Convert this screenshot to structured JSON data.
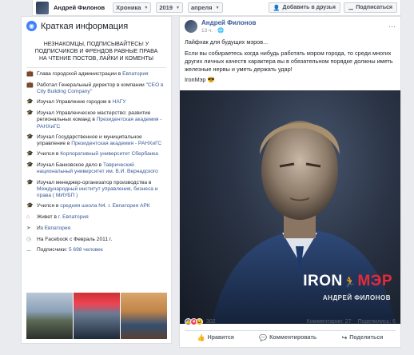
{
  "topbar": {
    "profile_name": "Андрей Филонов",
    "timeline_label": "Хроника",
    "year": "2019",
    "month": "апреля",
    "add_friend": "Добавить в друзья",
    "subscribe": "Подписаться"
  },
  "intro": {
    "title": "Краткая информация",
    "bio": "НЕЗНАКОМЦЫ, ПОДПИСЫВАЙТЕСЬ! У ПОДПИСЧИКОВ И ФРЕНДОВ РАВНЫЕ ПРАВА НА ЧТЕНИЕ ПОСТОВ, ЛАЙКИ И КОМЕНТЫ",
    "items": [
      {
        "icon": "briefcase-icon",
        "text": "Глава городской администрации в ",
        "link": "Евпатория"
      },
      {
        "icon": "briefcase-icon",
        "text": "Работал Генеральный директор в компании ",
        "link": "\"CEO в City Building Company\""
      },
      {
        "icon": "graduation-icon",
        "text": "Изучал Управление городом в ",
        "link": "НАГУ"
      },
      {
        "icon": "graduation-icon",
        "text": "Изучал Управленческое мастерство: развитие региональных команд в ",
        "link": "Президентская академия - РАНХиГС"
      },
      {
        "icon": "graduation-icon",
        "text": "Изучал Государственное и муниципальное управление в ",
        "link": "Президентская академия - РАНХиГС"
      },
      {
        "icon": "graduation-icon",
        "text": "Учился в ",
        "link": "Корпоративный университет Сбербанка"
      },
      {
        "icon": "graduation-icon",
        "text": "Изучал Банковское дело в ",
        "link": "Таврический национальный университет им. В.И. Вернадского"
      },
      {
        "icon": "graduation-icon",
        "text": "Изучал менеджер-организатор производства в ",
        "link": "Международный институт управления, бизнеса и права ( МИУБП )"
      },
      {
        "icon": "graduation-icon",
        "text": "Учился в ",
        "link": "средняя школа N4. г. Евпатория АРК"
      },
      {
        "icon": "home-icon",
        "text": "Живет в ",
        "link": "г. Евпатория"
      },
      {
        "icon": "location-icon",
        "text": "Из ",
        "link": "Евпатория"
      },
      {
        "icon": "clock-icon",
        "text": "На Facebook с Февраль 2011 г.",
        "link": ""
      },
      {
        "icon": "rss-icon",
        "text": "Подписчики: ",
        "link": "5 698 человек"
      }
    ]
  },
  "post": {
    "author": "Андрей Филонов",
    "time": "13 ч. · ",
    "lines": [
      "Лайфхак для будущих мэров...",
      "Если вы собираетесь когда нибудь работать мэром города, то среди многих других личных качеств характера вы в обязательном порядке должны иметь железные нервы и уметь держать удар!",
      "IronMэр 😎"
    ],
    "image_brand_iron": "IRON",
    "image_brand_mer": "МЭР",
    "image_subtitle": "АНДРЕЙ ФИЛОНОВ",
    "reactions_count": "302",
    "comments": "Комментарии: 27",
    "shares": "Поделились: 6",
    "like_label": "Нравится",
    "comment_label": "Комментировать",
    "share_label": "Поделиться"
  },
  "colors": {
    "accent": "#385898",
    "brand_iron": "#ffffff",
    "brand_mer": "#e52a3a"
  }
}
